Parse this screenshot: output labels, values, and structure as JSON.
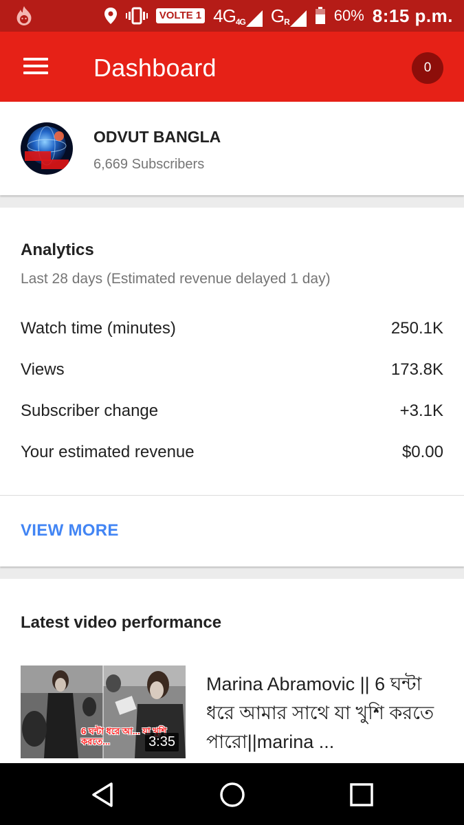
{
  "status_bar": {
    "volte_label": "VOLTE 1",
    "network_4g": "4G",
    "network_4g_sup": "4G",
    "network_g": "G",
    "network_g_sup": "R",
    "battery_percent": "60%",
    "time": "8:15 p.m."
  },
  "app_bar": {
    "title": "Dashboard",
    "notification_count": "0"
  },
  "channel": {
    "name": "ODVUT BANGLA",
    "subscribers": "6,669 Subscribers"
  },
  "analytics": {
    "title": "Analytics",
    "subtitle": "Last 28 days (Estimated revenue delayed 1 day)",
    "metrics": [
      {
        "label": "Watch time (minutes)",
        "value": "250.1K"
      },
      {
        "label": "Views",
        "value": "173.8K"
      },
      {
        "label": "Subscriber change",
        "value": "+3.1K"
      },
      {
        "label": "Your estimated revenue",
        "value": "$0.00"
      }
    ],
    "view_more_label": "VIEW MORE"
  },
  "latest_video": {
    "section_title": "Latest video performance",
    "duration": "3:35",
    "thumbnail_caption": "6 ঘন্টা ধরে আ... যা খুশি করতে...",
    "title": "Marina Abramovic || 6 ঘন্টা ধরে আমার সাথে যা খুশি করতে পারো||marina ..."
  },
  "colors": {
    "status_bar": "#b51c17",
    "app_bar": "#e62117",
    "badge": "#8d0e0a",
    "link": "#4285f4"
  }
}
